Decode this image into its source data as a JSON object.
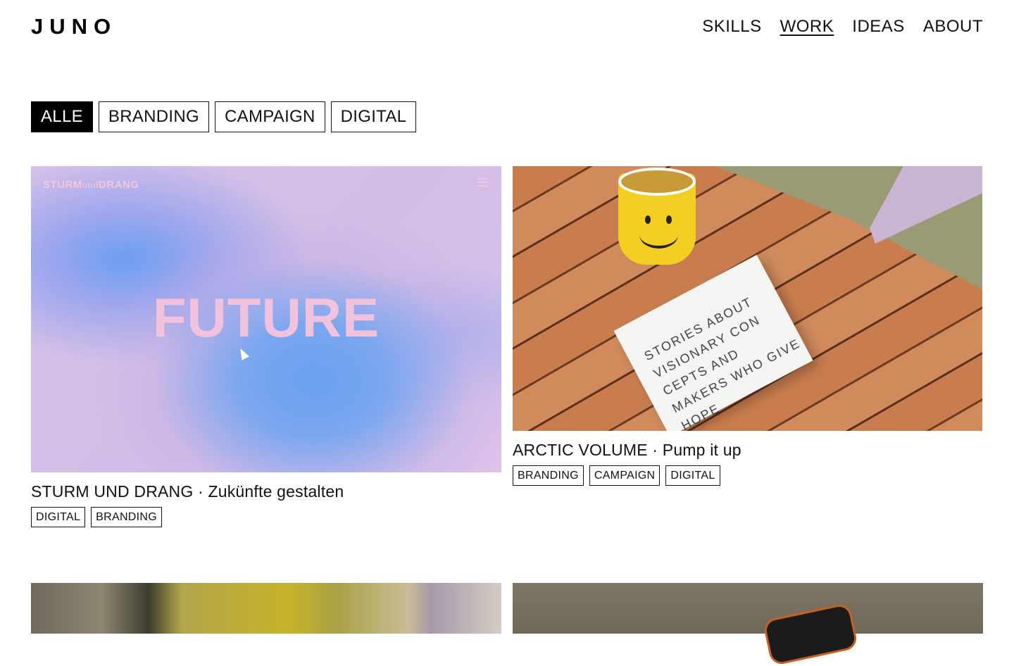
{
  "brand": {
    "logo": "JUNO"
  },
  "nav": {
    "items": [
      "SKILLS",
      "WORK",
      "IDEAS",
      "ABOUT"
    ],
    "active": "WORK"
  },
  "filters": {
    "items": [
      "ALLE",
      "BRANDING",
      "CAMPAIGN",
      "DIGITAL"
    ],
    "active": "ALLE"
  },
  "projects": [
    {
      "title": "STURM UND DRANG · Zukünfte gestalten",
      "tags": [
        "DIGITAL",
        "BRANDING"
      ],
      "image": {
        "brand_text_a": "STURM",
        "brand_text_b": "und",
        "brand_text_c": "DRANG",
        "headline": "FUTURE",
        "icon": "hamburger-menu-icon"
      }
    },
    {
      "title": "ARCTIC VOLUME · Pump it up",
      "tags": [
        "BRANDING",
        "CAMPAIGN",
        "DIGITAL"
      ],
      "image": {
        "book_text": "STORIES ABOUT VISIONARY CON CEPTS AND MAKERS WHO GIVE HOPE"
      }
    }
  ],
  "colors": {
    "text": "#111111",
    "background": "#ffffff",
    "active_filter_bg": "#000000"
  }
}
